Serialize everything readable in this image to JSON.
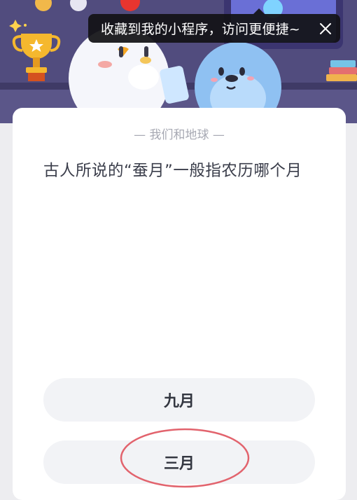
{
  "toast": {
    "message": "收藏到我的小程序，访问更便捷~",
    "close_icon": "close-icon"
  },
  "quiz": {
    "category": "— 我们和地球 —",
    "question": "古人所说的“蚕月”一般指农历哪个月",
    "options": [
      "九月",
      "三月"
    ]
  },
  "annotation": {
    "circled_option": "三月",
    "color": "#e2636d"
  }
}
